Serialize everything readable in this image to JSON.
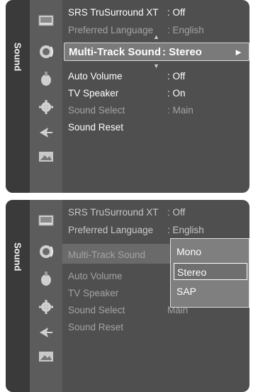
{
  "tab_label": "Sound",
  "icons": [
    "picture-icon",
    "sound-icon",
    "channel-icon",
    "setup-icon",
    "input-icon",
    "application-icon"
  ],
  "panel_top": {
    "rows": [
      {
        "label": "SRS TruSurround XT",
        "value": ": Off",
        "state": "on"
      },
      {
        "label": "Preferred Language",
        "value": ": English",
        "state": "dim"
      },
      {
        "label": "Multi-Track Sound",
        "value": ": Stereo",
        "state": "selected"
      },
      {
        "label": "Auto Volume",
        "value": ": Off",
        "state": "on"
      },
      {
        "label": "TV Speaker",
        "value": ": On",
        "state": "on"
      },
      {
        "label": "Sound Select",
        "value": ": Main",
        "state": "dim"
      },
      {
        "label": "Sound Reset",
        "value": "",
        "state": "on"
      }
    ],
    "arrow": "►"
  },
  "panel_bottom": {
    "rows": [
      {
        "label": "SRS TruSurround XT",
        "value": ": Off"
      },
      {
        "label": "Preferred Language",
        "value": ": English"
      },
      {
        "label": "Multi-Track Sound",
        "value": ""
      },
      {
        "label": "Auto Volume",
        "value": ""
      },
      {
        "label": "TV Speaker",
        "value": ""
      },
      {
        "label": "Sound Select",
        "value": "Main"
      },
      {
        "label": "Sound Reset",
        "value": ""
      }
    ],
    "dropdown": {
      "options": [
        "Mono",
        "Stereo",
        "SAP"
      ],
      "selected": "Stereo"
    }
  }
}
